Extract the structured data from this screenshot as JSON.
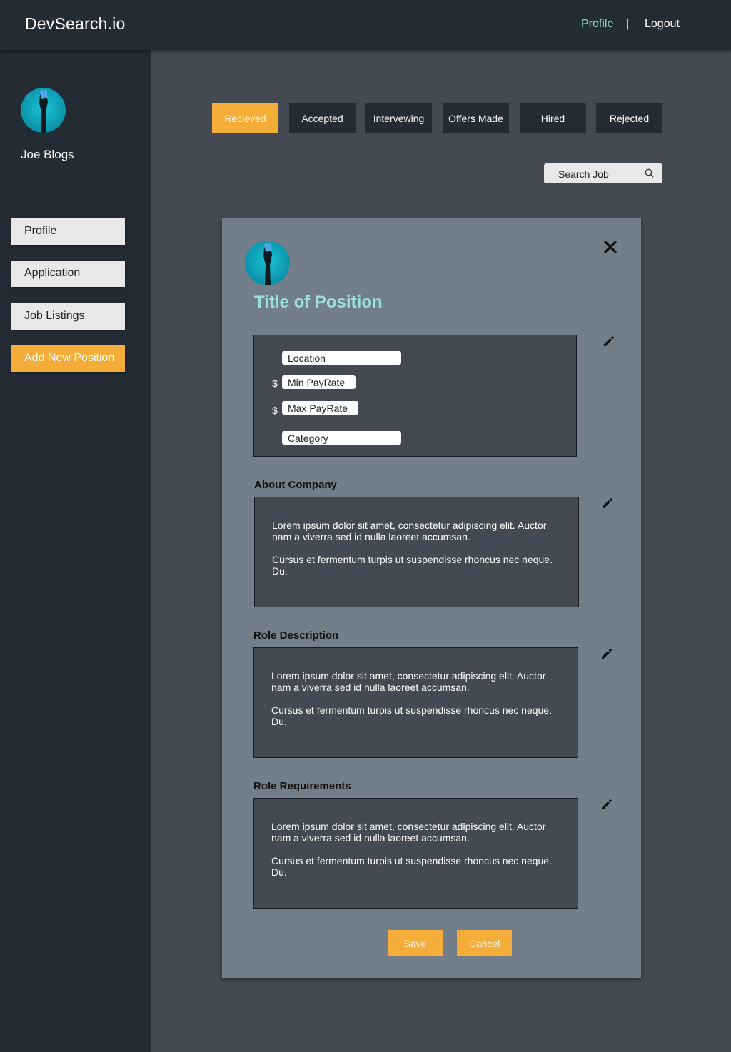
{
  "header": {
    "brand": "DevSearch.io",
    "nav_profile": "Profile",
    "nav_separator": "|",
    "nav_logout": "Logout"
  },
  "sidebar": {
    "user_name": "Joe Blogs",
    "items": [
      {
        "label": "Profile"
      },
      {
        "label": "Application"
      },
      {
        "label": "Job Listings"
      },
      {
        "label": "Add New Position"
      }
    ]
  },
  "tabs": [
    {
      "label": "Recieved",
      "active": true
    },
    {
      "label": "Accepted"
    },
    {
      "label": "Intervewing"
    },
    {
      "label": "Offers Made"
    },
    {
      "label": "Hired"
    },
    {
      "label": "Rejected"
    }
  ],
  "search": {
    "placeholder": "Search Job"
  },
  "modal": {
    "title": "Title of Position",
    "fields": {
      "location": "Location",
      "currency": "$",
      "min_pay": "Min PayRate",
      "max_pay": "Max PayRate",
      "category": "Category"
    },
    "sections": [
      {
        "label": "About Company",
        "p1": "Lorem ipsum dolor sit amet, consectetur adipiscing elit. Auctor nam a viverra sed id nulla laoreet accumsan.",
        "p2": "Cursus et fermentum turpis ut suspendisse rhoncus nec neque. Du."
      },
      {
        "label": "Role Description",
        "p1": "Lorem ipsum dolor sit amet, consectetur adipiscing elit. Auctor nam a viverra sed id nulla laoreet accumsan.",
        "p2": "Cursus et fermentum turpis ut suspendisse rhoncus nec neque. Du."
      },
      {
        "label": "Role Requirements",
        "p1": "Lorem ipsum dolor sit amet, consectetur adipiscing elit. Auctor nam a viverra sed id nulla laoreet accumsan.",
        "p2": "Cursus et fermentum turpis ut suspendisse rhoncus nec neque. Du."
      }
    ],
    "save_label": "Save",
    "cancel_label": "Cancel"
  },
  "colors": {
    "accent": "#f5ad3a",
    "topbar": "#232b35",
    "background": "#434a53",
    "modal": "#727f8a",
    "title": "#9be0d6"
  },
  "icons": [
    "avatar-image",
    "search-icon",
    "close-icon",
    "pencil-icon"
  ]
}
